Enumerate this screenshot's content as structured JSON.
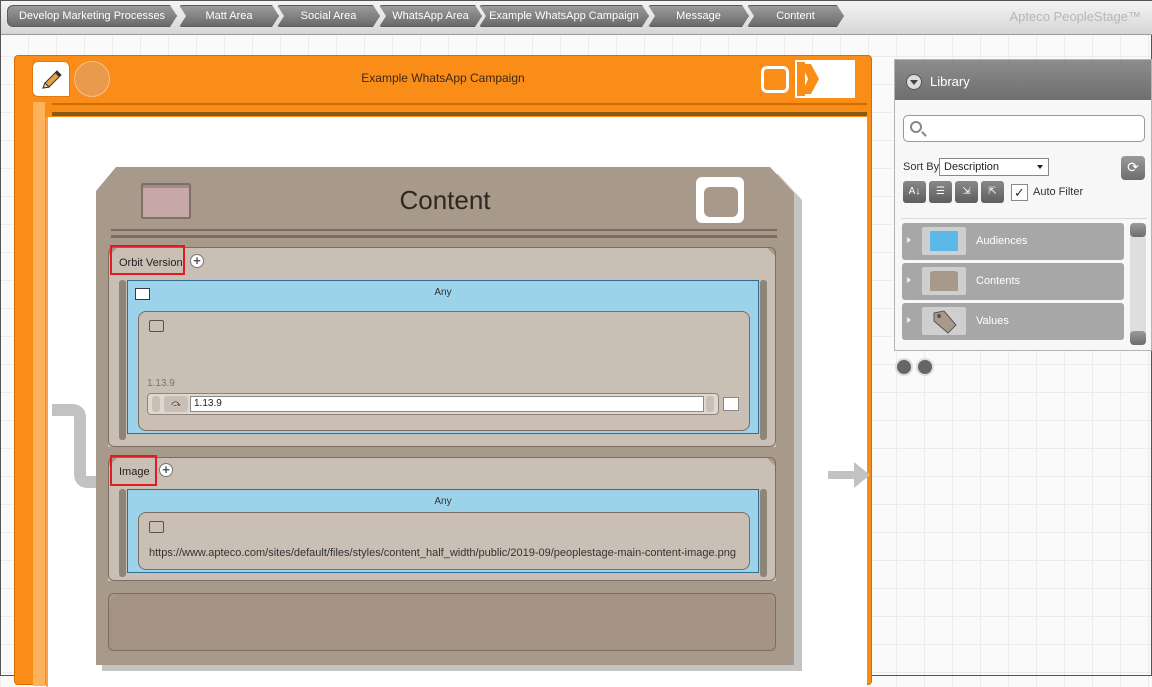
{
  "breadcrumbs": [
    "Develop Marketing Processes",
    "Matt Area",
    "Social Area",
    "WhatsApp Area",
    "Example WhatsApp Campaign",
    "Message",
    "Content"
  ],
  "brand": "Apteco PeopleStage™",
  "campaign": {
    "title": "Example WhatsApp Campaign"
  },
  "content_card": {
    "title": "Content",
    "sections": [
      {
        "label": "Orbit Version",
        "condition": "Any",
        "value_label": "1.13.9",
        "value": "1.13.9"
      },
      {
        "label": "Image",
        "condition": "Any",
        "value": "https://www.apteco.com/sites/default/files/styles/content_half_width/public/2019-09/peoplestage-main-content-image.png"
      }
    ]
  },
  "library": {
    "title": "Library",
    "search_placeholder": "",
    "sort_by_label": "Sort By",
    "sort_by_value": "Description",
    "auto_filter_label": "Auto Filter",
    "auto_filter_checked": true,
    "items": [
      {
        "label": "Audiences",
        "icon": "audience-icon",
        "color": "#5cb8e6"
      },
      {
        "label": "Contents",
        "icon": "content-icon",
        "color": "#a89a8b"
      },
      {
        "label": "Values",
        "icon": "tag-icon",
        "color": "#a89a8b"
      }
    ]
  },
  "colors": {
    "campaign_orange": "#fa8c18",
    "content_taupe": "#a89a8b",
    "condition_blue": "#9dd3ea",
    "highlight_red": "#e21b23"
  }
}
